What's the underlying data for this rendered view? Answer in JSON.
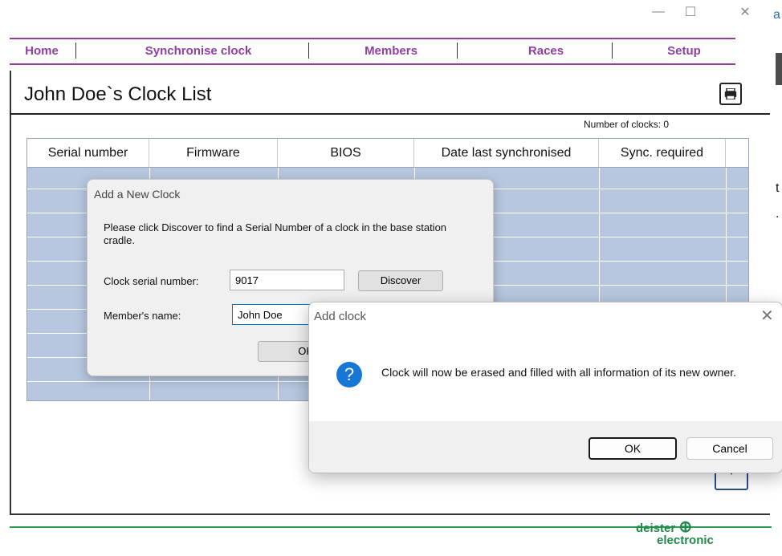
{
  "window": {
    "minimize_glyph": "—",
    "maximize_glyph": "☐",
    "close_glyph": "✕"
  },
  "menu": {
    "items": [
      "Home",
      "Synchronise clock",
      "Members",
      "Races",
      "Setup"
    ]
  },
  "page": {
    "title": "John Doe`s Clock List",
    "clock_count": "Number of clocks: 0"
  },
  "table": {
    "columns": [
      "Serial number",
      "Firmware",
      "BIOS",
      "Date last synchronised",
      "Sync. required"
    ]
  },
  "dialog_add_new_clock": {
    "title": "Add a New Clock",
    "message": "Please click Discover to find a Serial Number of a clock in the base station cradle.",
    "serial_label": "Clock serial number:",
    "serial_value": "9017",
    "discover_label": "Discover",
    "member_label": "Member's name:",
    "member_value": "John Doe",
    "ok_label": "OK"
  },
  "dialog_add_clock": {
    "title": "Add clock",
    "close_glyph": "✕",
    "icon_glyph": "?",
    "message": "Clock will now be erased and filled with all information of its new owner.",
    "ok_label": "OK",
    "cancel_label": "Cancel"
  },
  "footer": {
    "logo_line1": "deister",
    "logo_line2": "electronic",
    "logo_glyph": "⊕"
  },
  "edge": {
    "top_text": "a",
    "mid_text": "t",
    "dot_text": "."
  },
  "colors": {
    "menu_accent": "#8e3f9f",
    "table_fill": "#b6c7df",
    "brand_green": "#1f8a4a",
    "info_blue": "#1677d6"
  }
}
